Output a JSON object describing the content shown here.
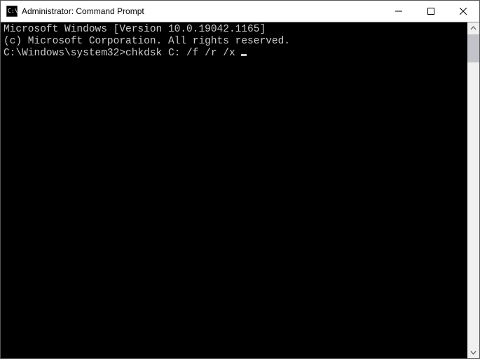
{
  "window": {
    "title": "Administrator: Command Prompt"
  },
  "terminal": {
    "line1": "Microsoft Windows [Version 10.0.19042.1165]",
    "line2": "(c) Microsoft Corporation. All rights reserved.",
    "blank": "",
    "prompt": "C:\\Windows\\system32>",
    "command": "chkdsk C: /f /r /x "
  }
}
